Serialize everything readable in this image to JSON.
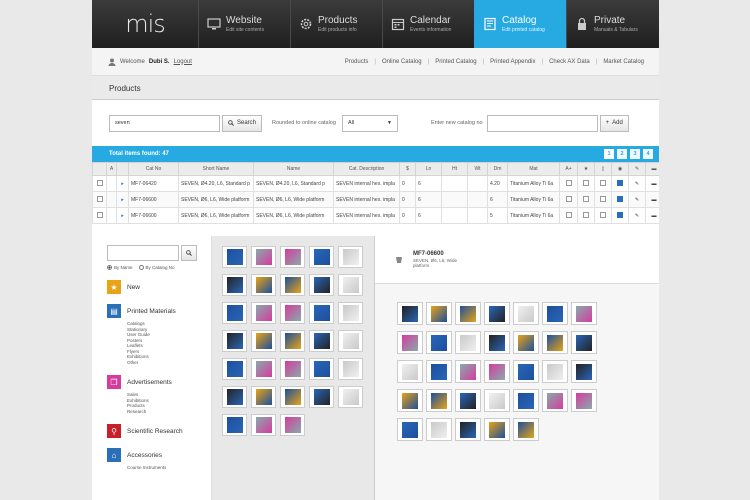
{
  "brand": {
    "logo": "mis"
  },
  "nav": [
    {
      "title": "Website",
      "sub": "Edit site contents",
      "icon": "monitor-icon"
    },
    {
      "title": "Products",
      "sub": "Edit products info",
      "icon": "gear-icon"
    },
    {
      "title": "Calendar",
      "sub": "Events information",
      "icon": "calendar-icon"
    },
    {
      "title": "Catalog",
      "sub": "Edit printed catalog",
      "icon": "catalog-icon"
    },
    {
      "title": "Private",
      "sub": "Manuals & Tabulars",
      "icon": "lock-icon"
    }
  ],
  "subbar": {
    "welcome": "Welcome",
    "user": "Dubi S.",
    "logout": "Logout",
    "links": [
      "Products",
      "Online Catalog",
      "Printed Catalog",
      "Printed Appendix",
      "Check AX Data",
      "Market Catalog"
    ]
  },
  "page": {
    "title": "Products"
  },
  "search": {
    "query": "seven",
    "search_label": "Search",
    "rounded_label": "Rounded to online catalog",
    "select_value": "All",
    "catalog_label": "Enter new catalog no",
    "add_label": "Add"
  },
  "results": {
    "total_label": "Total items found: 47",
    "pages": [
      "1",
      "2",
      "3",
      "4"
    ]
  },
  "table": {
    "headers": [
      "",
      "A",
      "",
      "Cat No",
      "Short Name",
      "Name",
      "Cat. Description",
      "$",
      "Ln",
      "Ht",
      "Wt",
      "Dm",
      "Mat",
      "A+",
      "",
      "",
      "",
      "",
      ""
    ],
    "rows": [
      {
        "cat": "MF7-06420",
        "short": "SEVEN, Ø4.20, L6, Standard p",
        "name": "SEVEN, Ø4.20, L6, Standard p",
        "desc": "SEVEN internal hex. impla",
        "price": "0",
        "ln": "6",
        "dm": "4.20",
        "mat": "Titanium Alloy Ti 6a"
      },
      {
        "cat": "MF7-06600",
        "short": "SEVEN, Ø6, L6, Wide platform",
        "name": "SEVEN, Ø6, L6, Wide platform",
        "desc": "SEVEN internal hex. impla",
        "price": "0",
        "ln": "6",
        "dm": "6",
        "mat": "Titanium Alloy Ti 6a"
      },
      {
        "cat": "MF7-06600",
        "short": "SEVEN, Ø6, L6, Wide platform",
        "name": "SEVEN, Ø6, L6, Wide platform",
        "desc": "SEVEN internal hex. impla",
        "price": "0",
        "ln": "6",
        "dm": "5",
        "mat": "Titanium Alloy Ti 6a"
      }
    ]
  },
  "sidebar": {
    "radio_name": "By Name",
    "radio_catalog": "By Catalog No",
    "categories": [
      {
        "title": "New",
        "color": "#e8a317",
        "subs": []
      },
      {
        "title": "Printed Materials",
        "color": "#2b6fb8",
        "subs": [
          "Catalogs",
          "Stationary",
          "User Guide",
          "Posters",
          "Leaflets",
          "Flyers",
          "Exhibitions",
          "Other"
        ]
      },
      {
        "title": "Advertisements",
        "color": "#d63ca0",
        "subs": [
          "Sales",
          "Exhibitions",
          "Products",
          "Research"
        ]
      },
      {
        "title": "Scientific Research",
        "color": "#c8202a",
        "subs": []
      },
      {
        "title": "Accessories",
        "color": "#2b6fb8",
        "subs": [
          "Course Instruments"
        ]
      }
    ]
  },
  "detail": {
    "cat": "MF7-06600",
    "desc": "SEVEN, Ø6, L6, Wide platform"
  }
}
